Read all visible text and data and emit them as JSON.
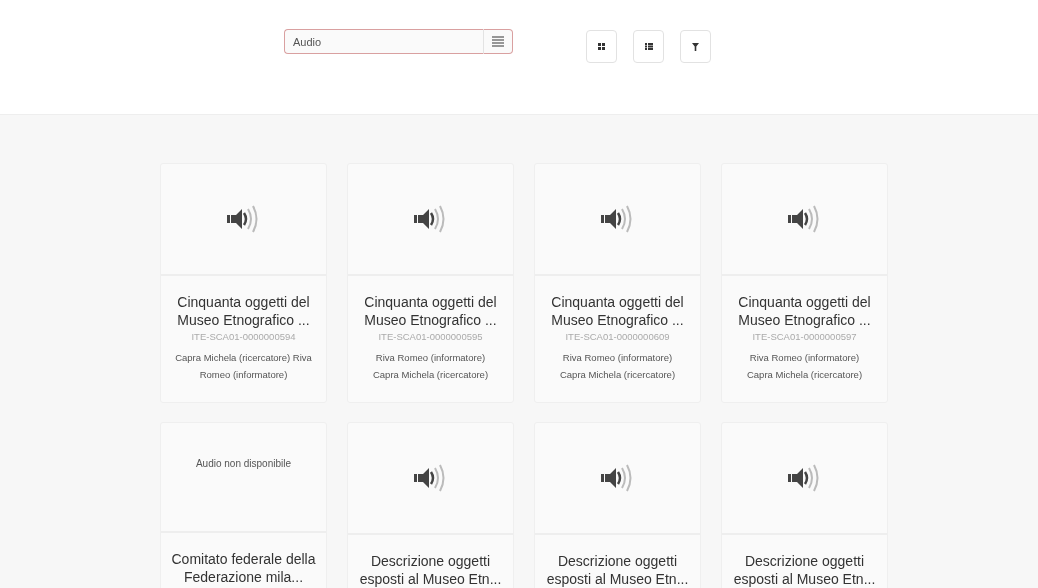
{
  "search": {
    "value": "Audio"
  },
  "cards": [
    {
      "kind": "audio",
      "title": "Cinquanta oggetti del Museo Etnografico ...",
      "code": "ITE-SCA01-0000000594",
      "people": "Capra Michela (ricercatore) Riva Romeo (informatore)"
    },
    {
      "kind": "audio",
      "title": "Cinquanta oggetti del Museo Etnografico ...",
      "code": "ITE-SCA01-0000000595",
      "people": "Riva Romeo (informatore) Capra Michela (ricercatore)"
    },
    {
      "kind": "audio",
      "title": "Cinquanta oggetti del Museo Etnografico ...",
      "code": "ITE-SCA01-0000000609",
      "people": "Riva Romeo (informatore) Capra Michela (ricercatore)"
    },
    {
      "kind": "audio",
      "title": "Cinquanta oggetti del Museo Etnografico ...",
      "code": "ITE-SCA01-0000000597",
      "people": "Riva Romeo (informatore) Capra Michela (ricercatore)"
    },
    {
      "kind": "unavailable",
      "media_text": "Audio non disponibile",
      "title": "Comitato federale della Federazione mila..."
    },
    {
      "kind": "audio",
      "title": "Descrizione oggetti esposti al Museo Etn..."
    },
    {
      "kind": "audio",
      "title": "Descrizione oggetti esposti al Museo Etn..."
    },
    {
      "kind": "audio",
      "title": "Descrizione oggetti esposti al Museo Etn..."
    }
  ]
}
